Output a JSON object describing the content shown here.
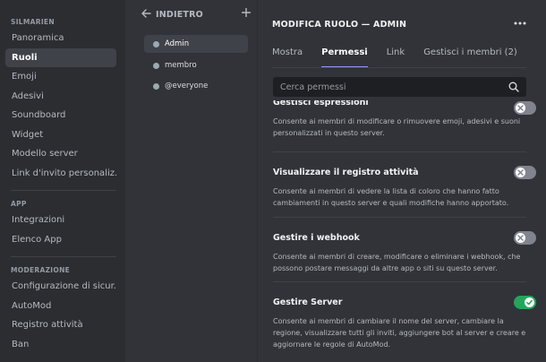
{
  "sidebar": {
    "server_header": "SILMARIEN",
    "server_items": [
      {
        "label": "Panoramica",
        "active": false
      },
      {
        "label": "Ruoli",
        "active": true
      },
      {
        "label": "Emoji",
        "active": false
      },
      {
        "label": "Adesivi",
        "active": false
      },
      {
        "label": "Soundboard",
        "active": false
      },
      {
        "label": "Widget",
        "active": false
      },
      {
        "label": "Modello server",
        "active": false
      },
      {
        "label": "Link d'invito personaliz...",
        "active": false
      }
    ],
    "app_header": "APP",
    "app_items": [
      {
        "label": "Integrazioni"
      },
      {
        "label": "Elenco App"
      }
    ],
    "mod_header": "MODERAZIONE",
    "mod_items": [
      {
        "label": "Configurazione di sicur..."
      },
      {
        "label": "AutoMod"
      },
      {
        "label": "Registro attività"
      },
      {
        "label": "Ban"
      }
    ]
  },
  "roles": {
    "back_label": "INDIETRO",
    "items": [
      {
        "label": "Admin",
        "active": true
      },
      {
        "label": "membro",
        "active": false
      },
      {
        "label": "@everyone",
        "active": false
      }
    ]
  },
  "main": {
    "title": "MODIFICA RUOLO — ADMIN",
    "tabs": [
      {
        "label": "Mostra",
        "active": false
      },
      {
        "label": "Permessi",
        "active": true
      },
      {
        "label": "Link",
        "active": false
      },
      {
        "label": "Gestisci i membri (2)",
        "active": false
      }
    ],
    "search_placeholder": "Cerca permessi",
    "permissions": [
      {
        "title": "Gestisci espressioni",
        "desc": "Consente ai membri di modificare o rimuovere emoji, adesivi e suoni personalizzati in questo server.",
        "enabled": false
      },
      {
        "title": "Visualizzare il registro attività",
        "desc": "Consente ai membri di vedere la lista di coloro che hanno fatto cambiamenti in questo server e quali modifiche hanno apportato.",
        "enabled": false
      },
      {
        "title": "Gestire i webhook",
        "desc": "Consente ai membri di creare, modificare o eliminare i webhook, che possono postare messaggi da altre app o siti su questo server.",
        "enabled": false
      },
      {
        "title": "Gestire Server",
        "desc": "Consente ai membri di cambiare il nome del server, cambiare la regione, visualizzare tutti gli inviti, aggiungere bot al server e creare e aggiornare le regole di AutoMod.",
        "enabled": true
      }
    ]
  },
  "colors": {
    "sidebar_bg": "#2b2d31",
    "content_bg": "#313338",
    "toggle_on": "#23a55a",
    "toggle_off": "#80848e",
    "tab_underline": "#949cf7"
  },
  "icons": [
    "back-arrow-icon",
    "plus-icon",
    "more-dots-icon",
    "search-icon",
    "x-icon",
    "check-icon"
  ]
}
